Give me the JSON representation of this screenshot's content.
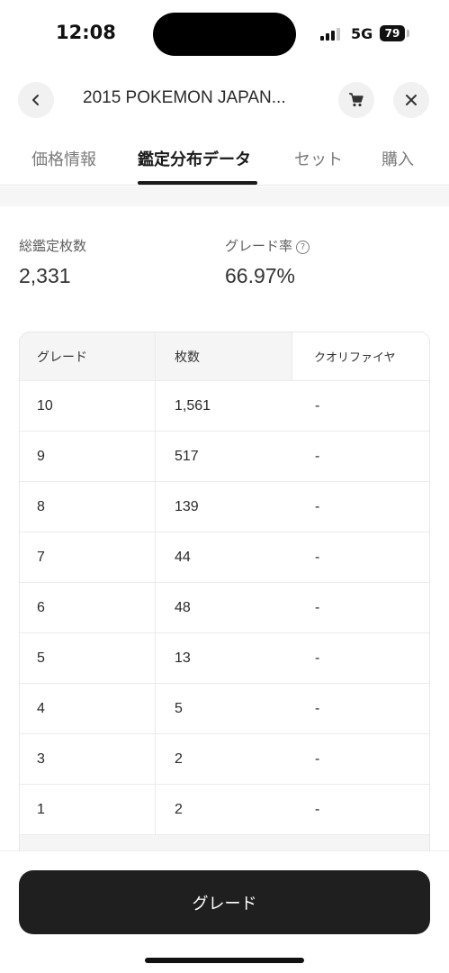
{
  "status": {
    "time": "12:08",
    "network": "5G",
    "battery": "79"
  },
  "header": {
    "title": "2015 POKEMON JAPAN...",
    "back_icon": "chevron-left-icon",
    "cart_icon": "cart-icon",
    "close_icon": "close-icon"
  },
  "tabs": [
    {
      "label": "価格情報",
      "active": false
    },
    {
      "label": "鑑定分布データ",
      "active": true
    },
    {
      "label": "セット",
      "active": false
    },
    {
      "label": "購入",
      "active": false
    }
  ],
  "stats": {
    "total_label": "総鑑定枚数",
    "total_value": "2,331",
    "rate_label": "グレード率",
    "rate_value": "66.97%",
    "help_icon": "help-circle-icon",
    "help_glyph": "?"
  },
  "table": {
    "headers": [
      "グレード",
      "枚数",
      "クオリファイヤ"
    ],
    "rows": [
      [
        "10",
        "1,561",
        "-"
      ],
      [
        "9",
        "517",
        "-"
      ],
      [
        "8",
        "139",
        "-"
      ],
      [
        "7",
        "44",
        "-"
      ],
      [
        "6",
        "48",
        "-"
      ],
      [
        "5",
        "13",
        "-"
      ],
      [
        "4",
        "5",
        "-"
      ],
      [
        "3",
        "2",
        "-"
      ],
      [
        "1",
        "2",
        "-"
      ]
    ]
  },
  "bottom": {
    "grade_button_label": "グレード"
  }
}
